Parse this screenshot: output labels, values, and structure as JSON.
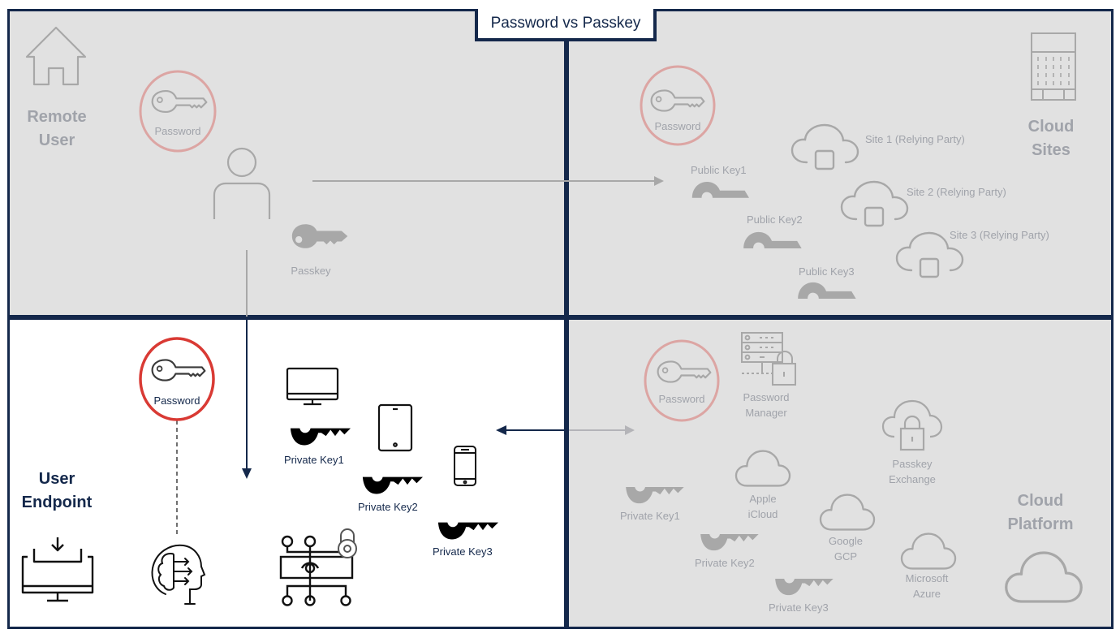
{
  "title": "Password vs Passkey",
  "colors": {
    "frame": "#14284b",
    "panel_faded": "#e1e1e1",
    "panel_active": "#ffffff",
    "password_ring_active": "#d93a34",
    "password_ring_faded": "#dca5a3",
    "faded_icon": "#a8a8a8",
    "faded_text": "#a0a3aa"
  },
  "quadrants": {
    "remote_user": {
      "title_line1": "Remote",
      "title_line2": "User",
      "password_label": "Password",
      "passkey_label": "Passkey"
    },
    "cloud_sites": {
      "title_line1": "Cloud",
      "title_line2": "Sites",
      "password_label": "Password",
      "public_keys": [
        "Public Key1",
        "Public Key2",
        "Public Key3"
      ],
      "sites": [
        "Site 1 (Relying Party)",
        "Site 2 (Relying Party)",
        "Site 3 (Relying Party)"
      ]
    },
    "user_endpoint": {
      "title_line1": "User",
      "title_line2": "Endpoint",
      "password_label": "Password",
      "private_keys": [
        "Private Key1",
        "Private Key2",
        "Private Key3"
      ]
    },
    "cloud_platform": {
      "title_line1": "Cloud",
      "title_line2": "Platform",
      "password_label": "Password",
      "password_manager_line1": "Password",
      "password_manager_line2": "Manager",
      "passkey_exchange_line1": "Passkey",
      "passkey_exchange_line2": "Exchange",
      "private_keys": [
        "Private Key1",
        "Private Key2",
        "Private Key3"
      ],
      "providers": [
        {
          "line1": "Apple",
          "line2": "iCloud"
        },
        {
          "line1": "Google",
          "line2": "GCP"
        },
        {
          "line1": "Microsoft",
          "line2": "Azure"
        }
      ]
    }
  }
}
